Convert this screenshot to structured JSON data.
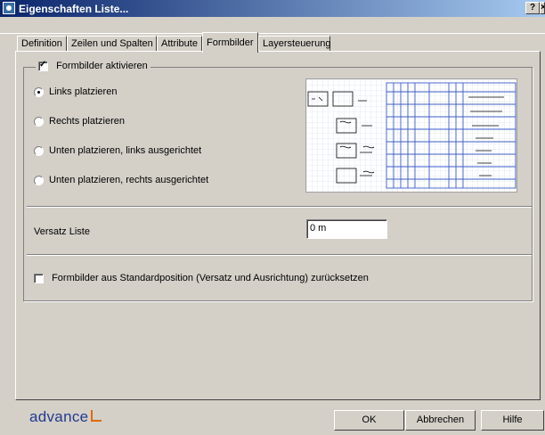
{
  "window": {
    "title": "Eigenschaften Liste...",
    "help_btn": "?",
    "close_btn": "×"
  },
  "tabs": [
    {
      "label": "Definition"
    },
    {
      "label": "Zeilen und Spalten"
    },
    {
      "label": "Attribute"
    },
    {
      "label": "Formbilder",
      "active": true
    },
    {
      "label": "Layersteuerung"
    }
  ],
  "group": {
    "checkbox_label": "Formbilder aktivieren",
    "checked": true,
    "radios": [
      {
        "label": "Links platzieren",
        "selected": true
      },
      {
        "label": "Rechts platzieren",
        "selected": false
      },
      {
        "label": "Unten platzieren, links ausgerichtet",
        "selected": false
      },
      {
        "label": "Unten platzieren, rechts ausgerichtet",
        "selected": false
      }
    ]
  },
  "offset": {
    "label": "Versatz Liste",
    "value": "0 m"
  },
  "reset": {
    "label": "Formbilder aus Standardposition (Versatz und Ausrichtung) zurücksetzen",
    "checked": false
  },
  "footer": {
    "logo": "advance",
    "ok": "OK",
    "cancel": "Abbrechen",
    "help": "Hilfe"
  },
  "colors": {
    "title_start": "#0a246a",
    "title_end": "#a6caf0",
    "face": "#d4d0c8",
    "preview_grid": "#3c5cc8",
    "logo": "#233a8f",
    "logo_accent": "#e06a00"
  }
}
